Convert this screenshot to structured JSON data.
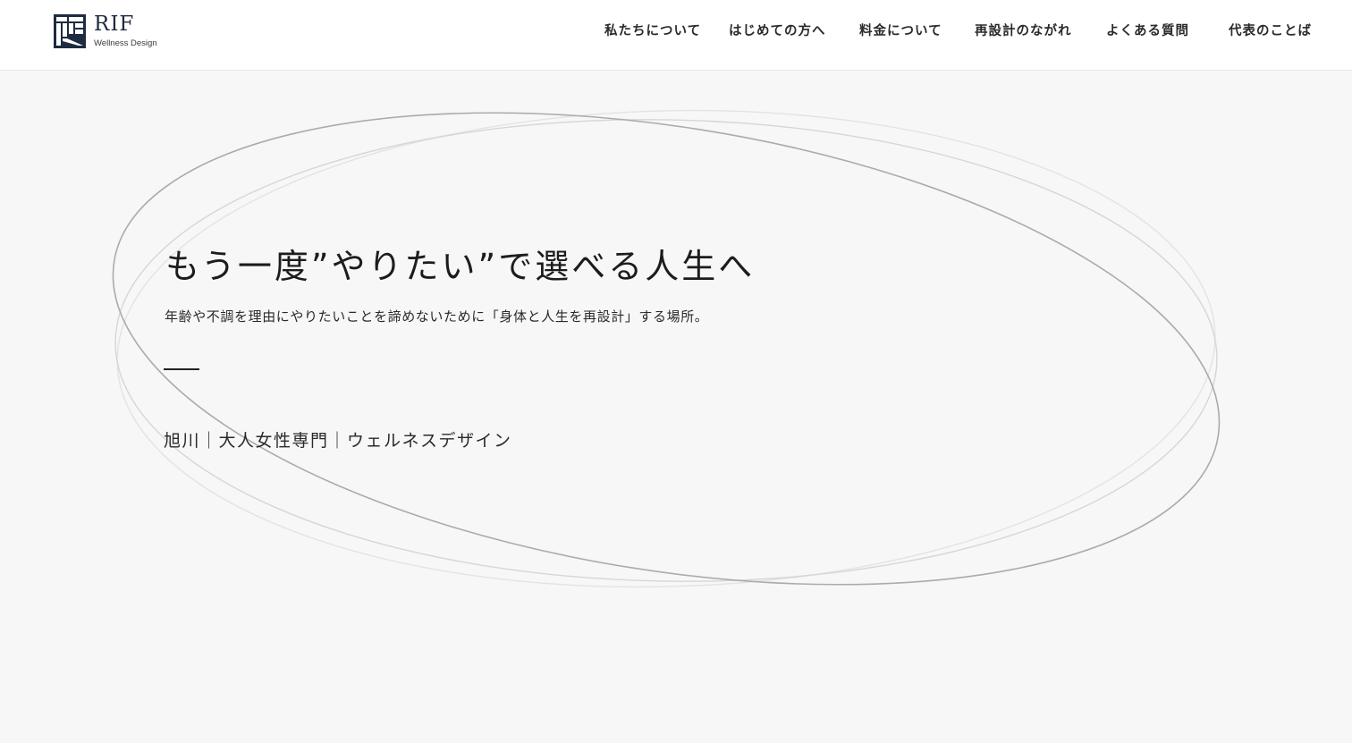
{
  "brand": {
    "name": "RIF",
    "sub": "Wellness Design",
    "color": "#1e2b40"
  },
  "nav": {
    "items": [
      {
        "label": "私たちについて"
      },
      {
        "label": "はじめての方へ"
      },
      {
        "label": "料金について"
      },
      {
        "label": "再設計のながれ"
      },
      {
        "label": "よくある質問"
      },
      {
        "label": "代表のことば"
      }
    ]
  },
  "hero": {
    "title": "もう一度”やりたい”で選べる人生へ",
    "subtitle": "年齢や不調を理由にやりたいことを諦めないために「身体と人生を再設計」する場所。",
    "tagline": "旭川｜大人女性専門｜ウェルネスデザイン"
  }
}
